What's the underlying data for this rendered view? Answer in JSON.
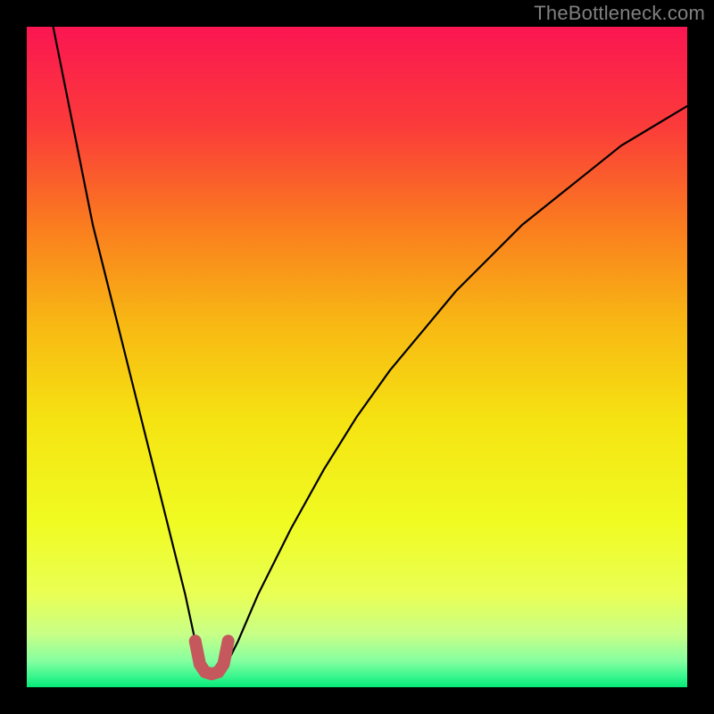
{
  "watermark": "TheBottleneck.com",
  "chart_data": {
    "type": "line",
    "title": "",
    "xlabel": "",
    "ylabel": "",
    "xlim": [
      0,
      100
    ],
    "ylim": [
      0,
      100
    ],
    "note": "V-shaped bottleneck curve over a red→yellow→green vertical gradient. Axes are unlabeled; values below are normalized 0–100 estimates read from pixel positions.",
    "series": [
      {
        "name": "bottleneck-curve",
        "x": [
          4,
          6,
          8,
          10,
          12,
          14,
          16,
          18,
          20,
          22,
          24,
          25.5,
          27,
          28,
          29,
          30,
          32,
          35,
          40,
          45,
          50,
          55,
          60,
          65,
          70,
          75,
          80,
          85,
          90,
          95,
          100
        ],
        "y": [
          100,
          90,
          80,
          70,
          62,
          54,
          46,
          38,
          30,
          22,
          14,
          7,
          3,
          2,
          2,
          3,
          7,
          14,
          24,
          33,
          41,
          48,
          54,
          60,
          65,
          70,
          74,
          78,
          82,
          85,
          88
        ]
      },
      {
        "name": "highlight-valley",
        "x": [
          25.5,
          26.2,
          27,
          28,
          29,
          29.8,
          30.5
        ],
        "y": [
          7,
          3.5,
          2.3,
          2,
          2.3,
          3.5,
          7
        ]
      }
    ],
    "gradient_stops": [
      {
        "offset": 0.0,
        "color": "#fb1652"
      },
      {
        "offset": 0.15,
        "color": "#fb3b3a"
      },
      {
        "offset": 0.3,
        "color": "#fa7c1f"
      },
      {
        "offset": 0.45,
        "color": "#f8b813"
      },
      {
        "offset": 0.6,
        "color": "#f5e412"
      },
      {
        "offset": 0.75,
        "color": "#f0fb22"
      },
      {
        "offset": 0.86,
        "color": "#e9ff55"
      },
      {
        "offset": 0.92,
        "color": "#c7ff87"
      },
      {
        "offset": 0.96,
        "color": "#86ffa0"
      },
      {
        "offset": 0.985,
        "color": "#35f58c"
      },
      {
        "offset": 1.0,
        "color": "#06e978"
      }
    ],
    "colors": {
      "curve": "#000000",
      "highlight": "#c4585c",
      "background_frame": "#000000"
    }
  }
}
